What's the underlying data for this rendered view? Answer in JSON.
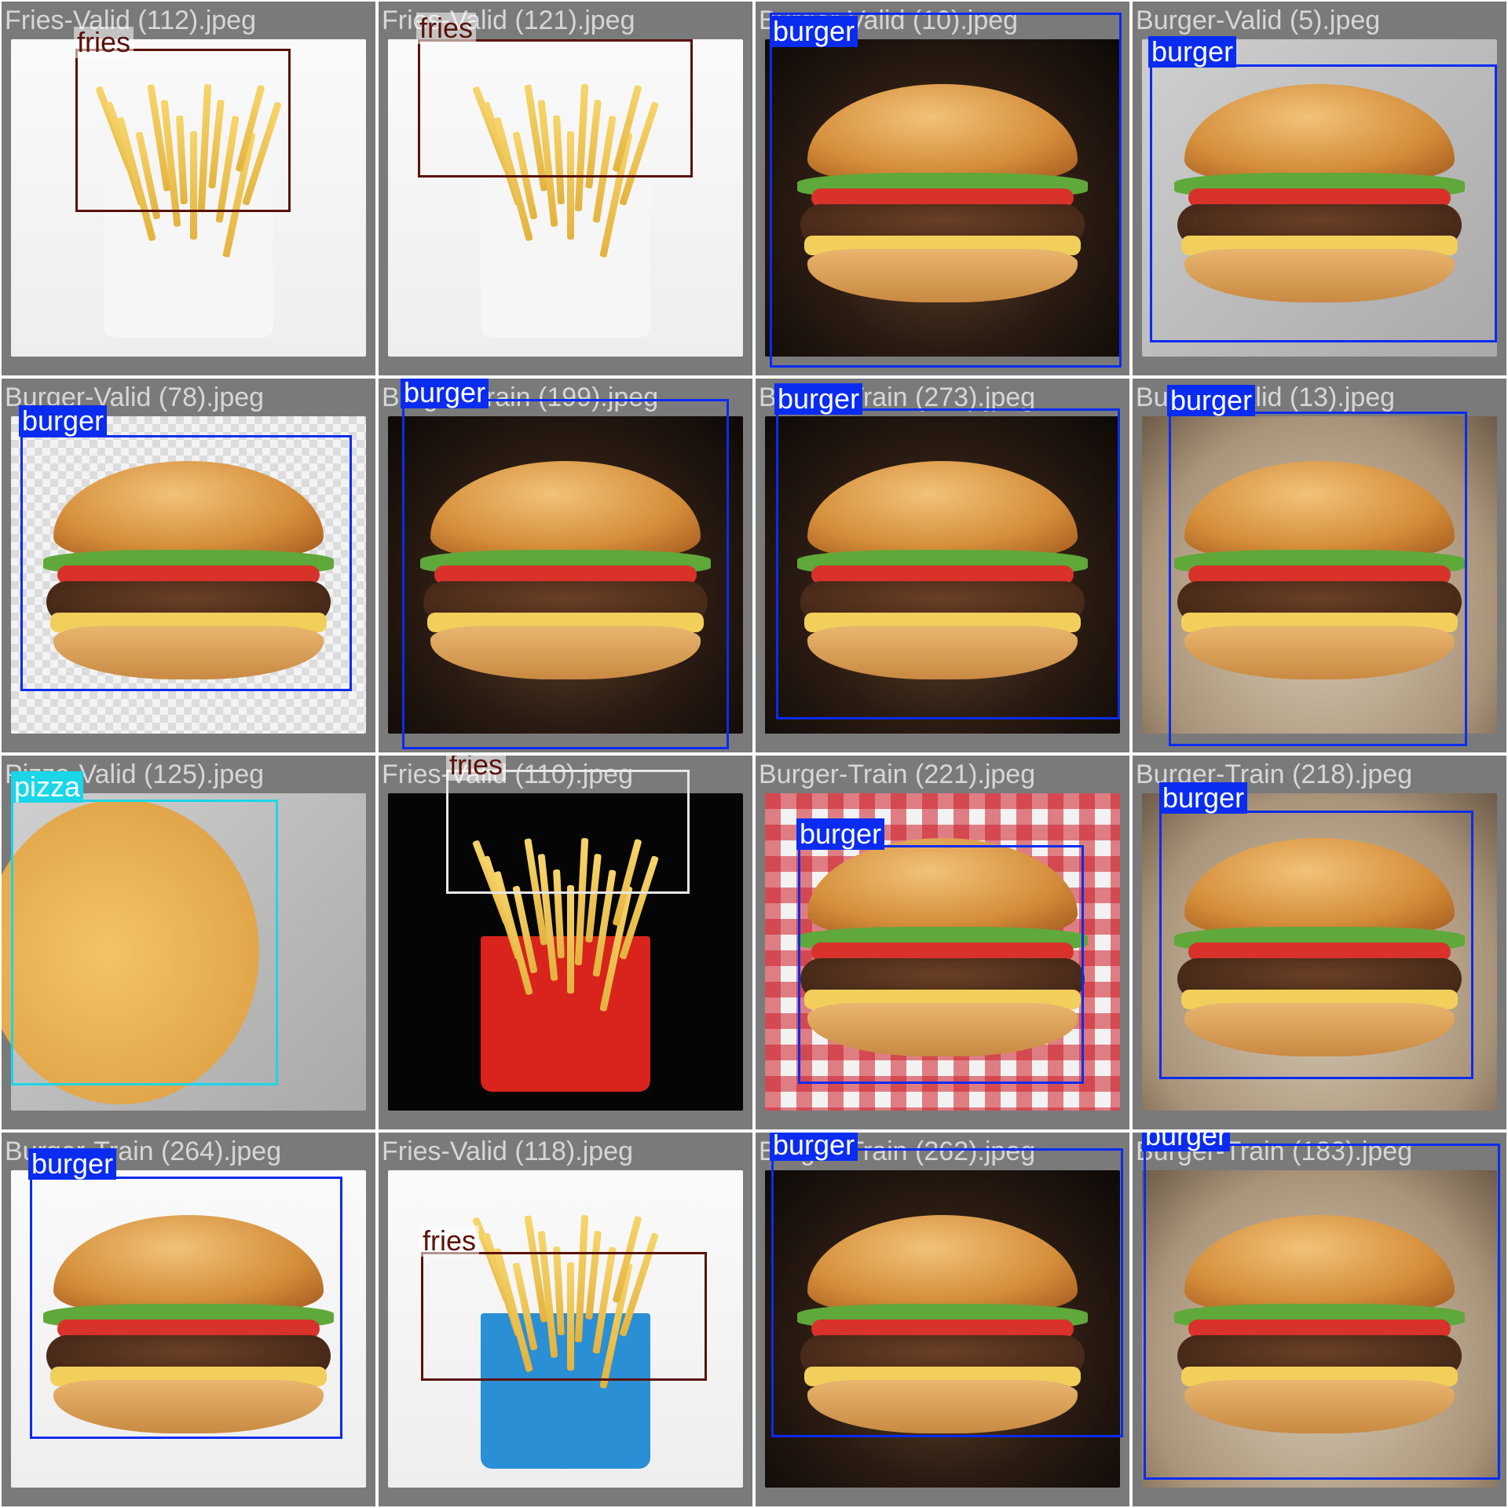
{
  "colors": {
    "burger": "#0a2cf0",
    "fries": "#5a1208",
    "fries_box": "#e7e7e7",
    "pizza": "#1ad6e6",
    "filename_text": "#e6e6e6",
    "tile_background": "#7a7a7a"
  },
  "tiles": [
    {
      "filename": "Fries-Valid (112).jpeg",
      "scene": "white",
      "food": "fries-bk",
      "detections": [
        {
          "label": "fries",
          "cls": "fries"
        }
      ]
    },
    {
      "filename": "Fries-Valid (121).jpeg",
      "scene": "white",
      "food": "fries-wendys",
      "detections": [
        {
          "label": "fries",
          "cls": "fries"
        }
      ]
    },
    {
      "filename": "Burger-Valid (10).jpeg",
      "scene": "dark",
      "food": "burger",
      "detections": [
        {
          "label": "burger",
          "cls": "burger"
        }
      ]
    },
    {
      "filename": "Burger-Valid (5).jpeg",
      "scene": "grey",
      "food": "burger",
      "detections": [
        {
          "label": "burger",
          "cls": "burger"
        }
      ]
    },
    {
      "filename": "Burger-Valid (78).jpeg",
      "scene": "checker",
      "food": "burger",
      "detections": [
        {
          "label": "burger",
          "cls": "burger"
        }
      ]
    },
    {
      "filename": "Burger-Train (199).jpeg",
      "scene": "dark",
      "food": "burger",
      "detections": [
        {
          "label": "burger",
          "cls": "burger"
        }
      ]
    },
    {
      "filename": "Burger-Train (273).jpeg",
      "scene": "dark",
      "food": "burger",
      "detections": [
        {
          "label": "burger",
          "cls": "burger"
        }
      ]
    },
    {
      "filename": "Burger-Valid (13).jpeg",
      "scene": "warm",
      "food": "burger",
      "detections": [
        {
          "label": "burger",
          "cls": "burger"
        }
      ]
    },
    {
      "filename": "Pizza-Valid (125).jpeg",
      "scene": "grey",
      "food": "pizza",
      "detections": [
        {
          "label": "pizza",
          "cls": "pizza"
        }
      ]
    },
    {
      "filename": "Fries-Valid (110).jpeg",
      "scene": "black",
      "food": "fries-mcd",
      "detections": [
        {
          "label": "fries",
          "cls": "fries_box"
        }
      ]
    },
    {
      "filename": "Burger-Train (221).jpeg",
      "scene": "redcheck",
      "food": "burger",
      "detections": [
        {
          "label": "burger",
          "cls": "burger"
        }
      ]
    },
    {
      "filename": "Burger-Train (218).jpeg",
      "scene": "warm",
      "food": "burger",
      "detections": [
        {
          "label": "burger",
          "cls": "burger"
        }
      ]
    },
    {
      "filename": "Burger-Train (264).jpeg",
      "scene": "white",
      "food": "burger",
      "detections": [
        {
          "label": "burger",
          "cls": "burger"
        }
      ]
    },
    {
      "filename": "Fries-Valid (118).jpeg",
      "scene": "white",
      "food": "fries-dq",
      "detections": [
        {
          "label": "fries",
          "cls": "fries"
        }
      ]
    },
    {
      "filename": "Burger-Train (262).jpeg",
      "scene": "dark",
      "food": "burger",
      "detections": [
        {
          "label": "burger",
          "cls": "burger"
        }
      ]
    },
    {
      "filename": "Burger-Train (183).jpeg",
      "scene": "warm",
      "food": "burger",
      "detections": [
        {
          "label": "burger",
          "cls": "burger"
        }
      ]
    }
  ]
}
